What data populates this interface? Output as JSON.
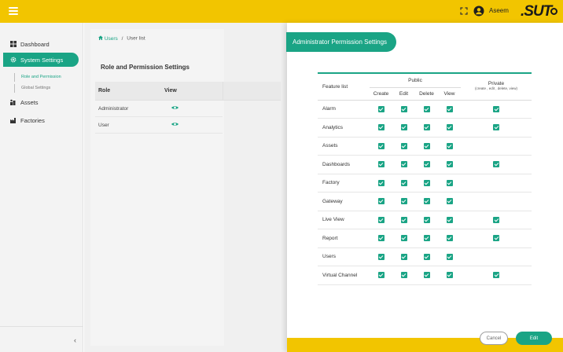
{
  "header": {
    "user_name": "Aseem",
    "brand": "SUTO",
    "icons": [
      "menu-icon",
      "expand-icon",
      "user-avatar-icon"
    ]
  },
  "sidebar": {
    "items": [
      {
        "label": "Dashboard",
        "icon": "dashboard-icon"
      },
      {
        "label": "System Settings",
        "icon": "gear-icon",
        "active": true
      },
      {
        "label": "Assets",
        "icon": "assets-icon"
      },
      {
        "label": "Factories",
        "icon": "factory-icon"
      }
    ],
    "sub_items": [
      {
        "label": "Role and Permission",
        "active": true
      },
      {
        "label": "Global Settings",
        "active": false
      }
    ],
    "collapse_glyph": "‹"
  },
  "main": {
    "breadcrumb": {
      "link": "Users",
      "separator": "/",
      "current": "User list"
    },
    "section_title": "Role and Permission Settings",
    "role_table": {
      "headers": [
        "Role",
        "View"
      ],
      "rows": [
        {
          "role": "Administrator"
        },
        {
          "role": "User"
        }
      ]
    }
  },
  "drawer": {
    "title": "Administrator Permission Settings",
    "table": {
      "feature_header": "Feature list",
      "public_header": "Public",
      "public_columns": [
        "Create",
        "Edit",
        "Delete",
        "View"
      ],
      "private_header": "Private",
      "private_sub": "(create , edit , delete, view)",
      "rows": [
        {
          "feature": "Alarm",
          "public": [
            true,
            true,
            true,
            true
          ],
          "private": true
        },
        {
          "feature": "Analytics",
          "public": [
            true,
            true,
            true,
            true
          ],
          "private": true
        },
        {
          "feature": "Assets",
          "public": [
            true,
            true,
            true,
            true
          ],
          "private": false
        },
        {
          "feature": "Dashboards",
          "public": [
            true,
            true,
            true,
            true
          ],
          "private": true
        },
        {
          "feature": "Factory",
          "public": [
            true,
            true,
            true,
            true
          ],
          "private": false
        },
        {
          "feature": "Gateway",
          "public": [
            true,
            true,
            true,
            true
          ],
          "private": false
        },
        {
          "feature": "Live View",
          "public": [
            true,
            true,
            true,
            true
          ],
          "private": true
        },
        {
          "feature": "Report",
          "public": [
            true,
            true,
            true,
            true
          ],
          "private": true
        },
        {
          "feature": "Users",
          "public": [
            true,
            true,
            true,
            true
          ],
          "private": false
        },
        {
          "feature": "Virtual Channel",
          "public": [
            true,
            true,
            true,
            true
          ],
          "private": true
        }
      ]
    },
    "buttons": {
      "cancel": "Cancel",
      "edit": "Edit"
    }
  },
  "colors": {
    "accent": "#1aa485",
    "topbar": "#f2c500",
    "sidebar_bg": "#f3f3f3"
  }
}
